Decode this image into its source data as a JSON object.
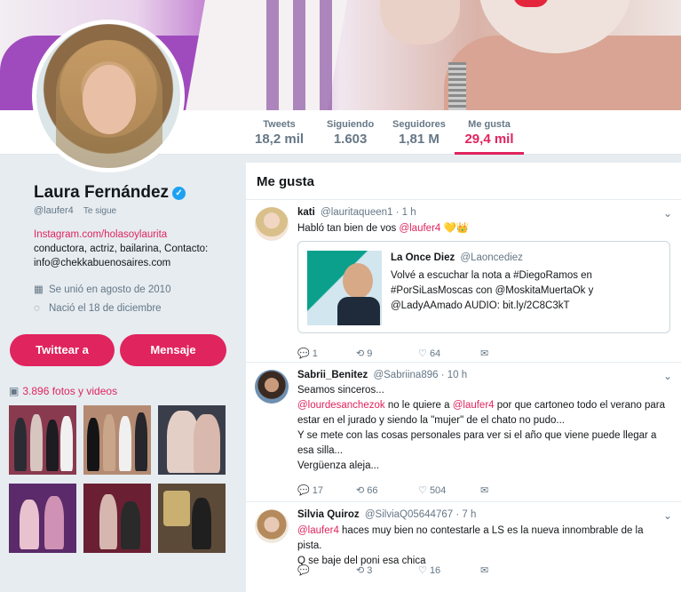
{
  "profile": {
    "name": "Laura Fernández",
    "handle": "@laufer4",
    "follows_you": "Te sigue",
    "bio_link": "Instagram.com/holasoylaurita",
    "bio": "conductora, actriz, bailarina, Contacto: info@chekkabuenosaires.com",
    "joined": "Se unió en agosto de 2010",
    "birthday": "Nació el 18 de diciembre",
    "tweet_to_button": "Twittear a",
    "message_button": "Mensaje",
    "media_label": "3.896 fotos y videos"
  },
  "stats": [
    {
      "label": "Tweets",
      "value": "18,2 mil"
    },
    {
      "label": "Siguiendo",
      "value": "1.603"
    },
    {
      "label": "Seguidores",
      "value": "1,81 M"
    },
    {
      "label": "Me gusta",
      "value": "29,4 mil"
    }
  ],
  "timeline": {
    "title": "Me gusta",
    "tweets": [
      {
        "name": "kati",
        "handle": "@lauritaqueen1",
        "time": "· 1 h",
        "text_pre": "Habló tan bien de vos ",
        "mention": "@laufer4",
        "text_post": " 💛👑",
        "quote": {
          "name": "La Once Diez",
          "handle": "@Laoncediez",
          "text": "Volvé a escuchar la nota a #DiegoRamos en #PorSiLasMoscas con @MoskitaMuertaOk y @LadyAAmado AUDIO: bit.ly/2C8C3kT"
        },
        "replies": "1",
        "retweets": "9",
        "likes": "64"
      },
      {
        "name": "Sabrii_Benitez",
        "handle": "@Sabriina896",
        "time": "· 10 h",
        "line1": "Seamos sinceros...",
        "mention1": "@lourdesanchezok",
        "line2_mid": " no le quiere a ",
        "mention2": "@laufer4",
        "line2_post": " por que cartoneo todo el verano para estar en el jurado y siendo la \"mujer\" de el chato no pudo...",
        "line3": "Y se mete con las cosas personales para ver si el año que viene puede llegar a esa silla...",
        "line4": "Vergüenza aleja...",
        "replies": "17",
        "retweets": "66",
        "likes": "504"
      },
      {
        "name": "Silvia Quiroz",
        "handle": "@SilviaQ05644767",
        "time": "· 7 h",
        "mention": "@laufer4",
        "text_post": " haces muy bien no contestarle a LS es la nueva innombrable de la pista.",
        "line2": "Q se baje del poni esa chica",
        "replies": "",
        "retweets": "3",
        "likes": "16"
      }
    ]
  },
  "icons": {
    "reply": "💬",
    "retweet": "⟲",
    "like": "♡",
    "dm": "✉"
  }
}
